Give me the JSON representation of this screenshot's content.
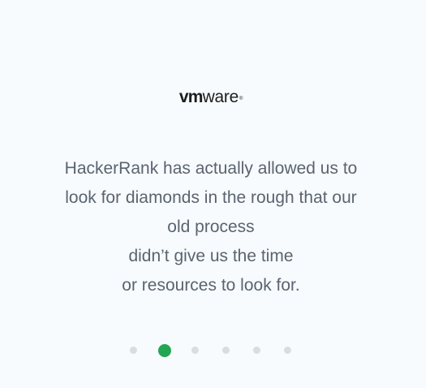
{
  "testimonial": {
    "logo": {
      "part_bold": "vm",
      "part_regular": "ware",
      "mark": "®"
    },
    "quote_lines": [
      "HackerRank has actually allowed us to",
      "look for diamonds in the rough that our",
      "old process",
      "didn’t give us the time",
      "or resources to look for."
    ]
  },
  "carousel": {
    "slide_count": 6,
    "active_index": 1,
    "active_color": "#22a653",
    "inactive_color": "#d8dde2"
  }
}
